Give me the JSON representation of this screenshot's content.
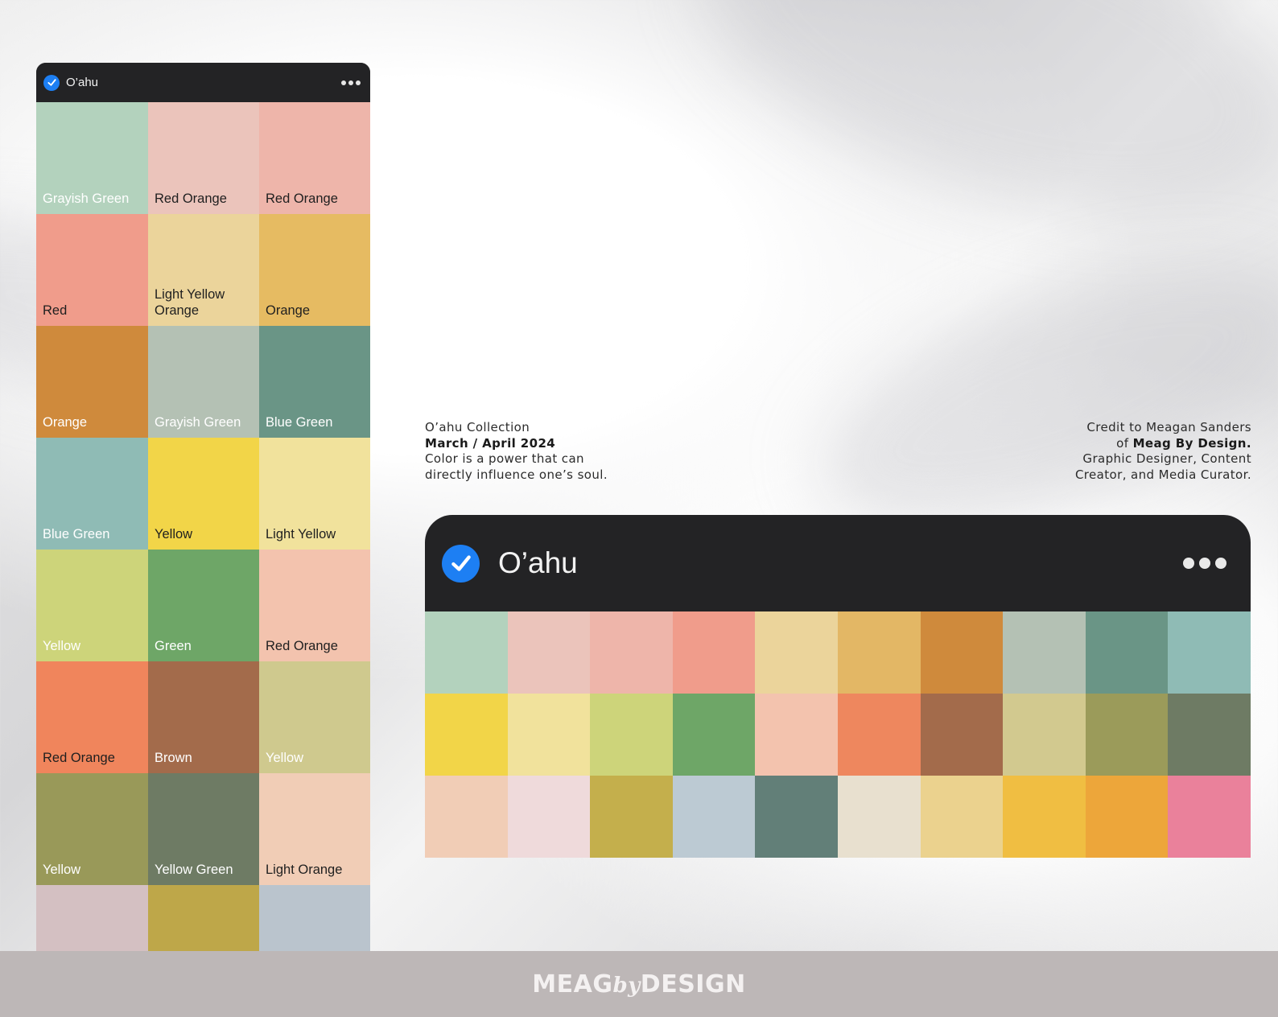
{
  "palette_name": "O’ahu",
  "left_panel": {
    "title": "O’ahu",
    "swatches": [
      {
        "label": "Grayish Green",
        "color": "#b3d2bd",
        "text_color": "#ffffff"
      },
      {
        "label": "Red Orange",
        "color": "#ebc4bb",
        "text_color": "#1f1f1f"
      },
      {
        "label": "Red Orange",
        "color": "#eeb5aa",
        "text_color": "#1f1f1f"
      },
      {
        "label": "Red",
        "color": "#f09c8b",
        "text_color": "#1f1f1f"
      },
      {
        "label": "Light Yellow Orange",
        "color": "#ebd49b",
        "text_color": "#1f1f1f"
      },
      {
        "label": "Orange",
        "color": "#e6bb62",
        "text_color": "#1f1f1f"
      },
      {
        "label": "Orange",
        "color": "#cf8a3c",
        "text_color": "#ffffff"
      },
      {
        "label": "Grayish Green",
        "color": "#b4c1b4",
        "text_color": "#ffffff"
      },
      {
        "label": "Blue Green",
        "color": "#6a9586",
        "text_color": "#ffffff"
      },
      {
        "label": "Blue Green",
        "color": "#8fbbb5",
        "text_color": "#ffffff"
      },
      {
        "label": "Yellow",
        "color": "#f2d548",
        "text_color": "#1f1f1f"
      },
      {
        "label": "Light Yellow",
        "color": "#f1e29c",
        "text_color": "#1f1f1f"
      },
      {
        "label": "Yellow",
        "color": "#cdd47a",
        "text_color": "#ffffff"
      },
      {
        "label": "Green",
        "color": "#6ea667",
        "text_color": "#ffffff"
      },
      {
        "label": "Red Orange",
        "color": "#f3c3ae",
        "text_color": "#1f1f1f"
      },
      {
        "label": "Red Orange",
        "color": "#f0855c",
        "text_color": "#1f1f1f"
      },
      {
        "label": "Brown",
        "color": "#a36b4b",
        "text_color": "#ffffff"
      },
      {
        "label": "Yellow",
        "color": "#cfc98e",
        "text_color": "#ffffff"
      },
      {
        "label": "Yellow",
        "color": "#999959",
        "text_color": "#ffffff"
      },
      {
        "label": "Yellow Green",
        "color": "#6e7b64",
        "text_color": "#ffffff"
      },
      {
        "label": "Light Orange",
        "color": "#f1cdb6",
        "text_color": "#1f1f1f"
      },
      {
        "label": "",
        "color": "#d4c0c2",
        "text_color": "#1f1f1f"
      },
      {
        "label": "",
        "color": "#bea749",
        "text_color": "#1f1f1f"
      },
      {
        "label": "",
        "color": "#bac4cd",
        "text_color": "#1f1f1f"
      }
    ]
  },
  "caption_left": {
    "line1": "O’ahu Collection",
    "line2": "March / April 2024",
    "line3": "Color is a power that can",
    "line4": "directly influence one’s soul."
  },
  "caption_right": {
    "line1": "Credit to Meagan Sanders",
    "line2_prefix": "of ",
    "line2_bold": "Meag By Design.",
    "line3": "Graphic Designer, Content",
    "line4": "Creator, and Media Curator."
  },
  "right_panel": {
    "title": "O’ahu",
    "colors": [
      "#b3d2bd",
      "#ebc4bb",
      "#eeb5aa",
      "#f09c8b",
      "#ebd49b",
      "#e3b765",
      "#cf8a3c",
      "#b4c1b4",
      "#6a9586",
      "#8fbbb5",
      "#f2d548",
      "#f1e29c",
      "#cdd47a",
      "#6ea667",
      "#f3c3ae",
      "#ee875e",
      "#a36b4b",
      "#d2c98f",
      "#9b9b5a",
      "#6e7b64",
      "#f1cdb6",
      "#efdadb",
      "#c4af4c",
      "#bccad3",
      "#627f78",
      "#e8e0cf",
      "#ebd28e",
      "#f0be42",
      "#eda63a",
      "#ea819b"
    ]
  },
  "footer": {
    "brand_left": "MEAG",
    "brand_mid": "by",
    "brand_right": "DESIGN"
  }
}
